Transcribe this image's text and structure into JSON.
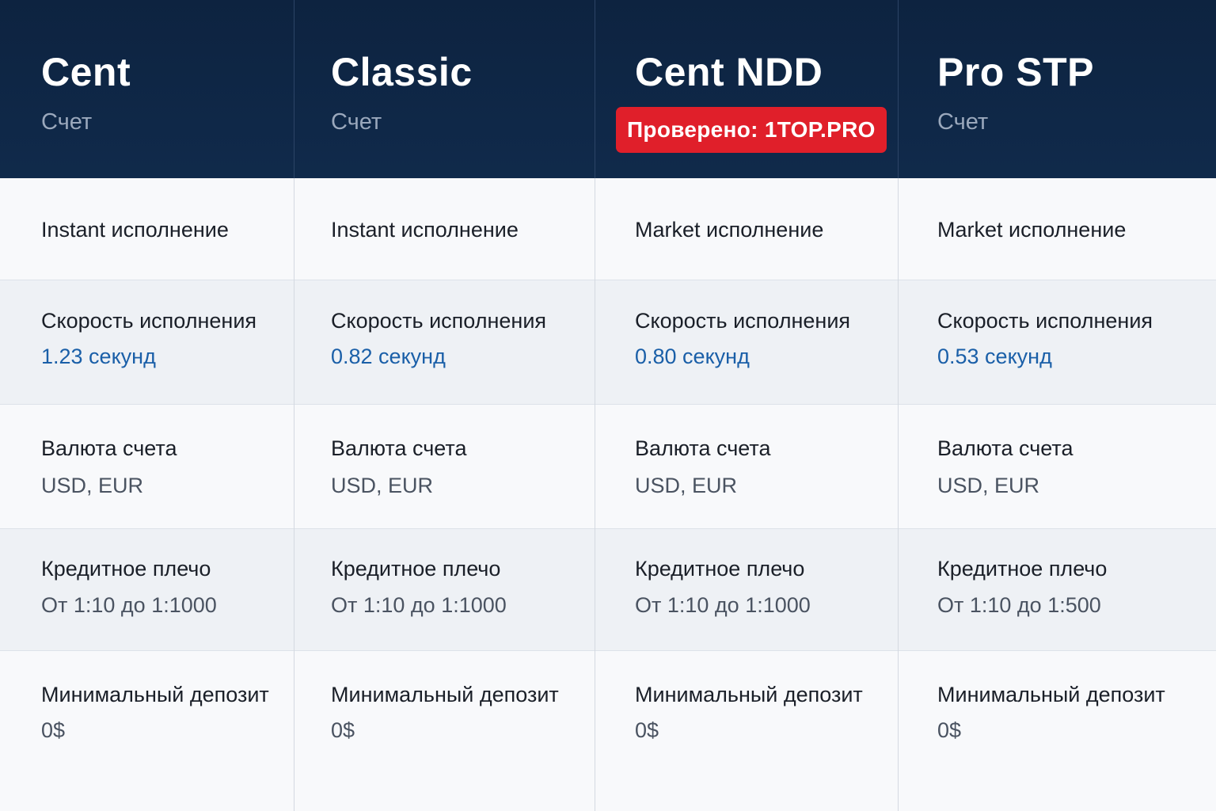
{
  "columns": [
    {
      "name": "Cent",
      "subtitle": "Счет",
      "execution": "Instant исполнение",
      "speed_label": "Скорость исполнения",
      "speed_value": "1.23 секунд",
      "currency_label": "Валюта счета",
      "currency_value": "USD, EUR",
      "leverage_label": "Кредитное плечо",
      "leverage_value": "От 1:10 до 1:1000",
      "deposit_label": "Минимальный депозит",
      "deposit_value": "0$"
    },
    {
      "name": "Classic",
      "subtitle": "Счет",
      "execution": "Instant исполнение",
      "speed_label": "Скорость исполнения",
      "speed_value": "0.82 секунд",
      "currency_label": "Валюта счета",
      "currency_value": "USD, EUR",
      "leverage_label": "Кредитное плечо",
      "leverage_value": "От 1:10 до 1:1000",
      "deposit_label": "Минимальный депозит",
      "deposit_value": "0$"
    },
    {
      "name": "Cent NDD",
      "badge": "Проверено: 1TOP.PRO",
      "execution": "Market исполнение",
      "speed_label": "Скорость исполнения",
      "speed_value": "0.80 секунд",
      "currency_label": "Валюта счета",
      "currency_value": "USD, EUR",
      "leverage_label": "Кредитное плечо",
      "leverage_value": "От 1:10 до 1:1000",
      "deposit_label": "Минимальный депозит",
      "deposit_value": "0$"
    },
    {
      "name": "Pro STP",
      "subtitle": "Счет",
      "execution": "Market исполнение",
      "speed_label": "Скорость исполнения",
      "speed_value": "0.53 секунд",
      "currency_label": "Валюта счета",
      "currency_value": "USD, EUR",
      "leverage_label": "Кредитное плечо",
      "leverage_value": "От 1:10 до 1:500",
      "deposit_label": "Минимальный депозит",
      "deposit_value": "0$"
    }
  ],
  "colors": {
    "header_bg": "#0d2340",
    "badge_bg": "#e01f2a",
    "speed_value": "#1a5fa8"
  }
}
